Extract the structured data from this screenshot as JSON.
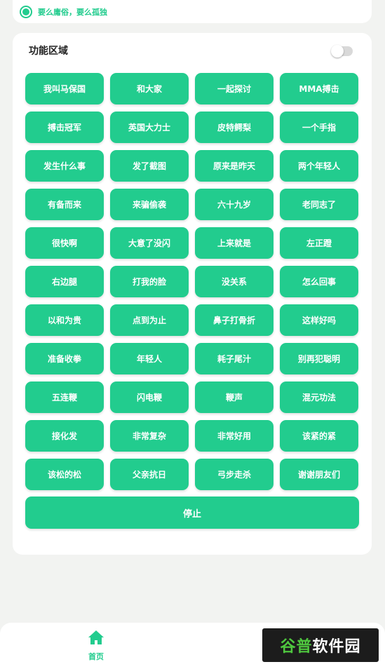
{
  "header": {
    "slogan": "要么庸俗，要么孤独",
    "accent_color": "#22cc8e"
  },
  "section": {
    "title": "功能区域",
    "toggle_on": false
  },
  "buttons": [
    "我叫马保国",
    "和大家",
    "一起探讨",
    "MMA搏击",
    "搏击冠军",
    "英国大力士",
    "皮特鳄梨",
    "一个手指",
    "发生什么事",
    "发了截图",
    "原来是昨天",
    "两个年轻人",
    "有备而来",
    "来骗偷袭",
    "六十九岁",
    "老同志了",
    "很快啊",
    "大意了没闪",
    "上来就是",
    "左正蹬",
    "右边腿",
    "打我的脸",
    "没关系",
    "怎么回事",
    "以和为贵",
    "点到为止",
    "鼻子打骨折",
    "这样好吗",
    "准备收拳",
    "年轻人",
    "耗子尾汁",
    "别再犯聪明",
    "五连鞭",
    "闪电鞭",
    "鞭声",
    "混元功法",
    "接化发",
    "非常复杂",
    "非常好用",
    "该紧的紧",
    "该松的松",
    "父亲抗日",
    "弓步走杀",
    "谢谢朋友们"
  ],
  "stop_label": "停止",
  "nav": {
    "home_label": "首页",
    "home_icon": "home-icon"
  },
  "watermark": {
    "part1": "谷普",
    "part2": "软件园"
  }
}
